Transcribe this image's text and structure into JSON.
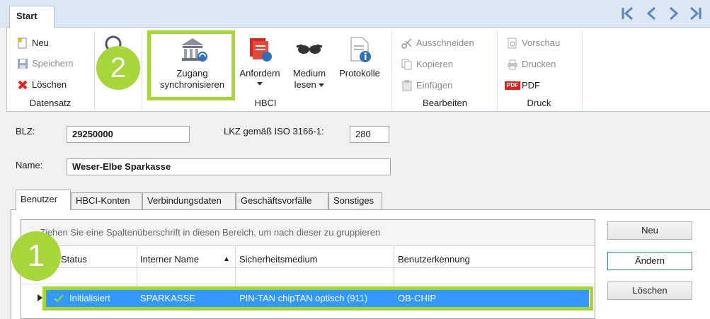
{
  "tabs": {
    "start": "Start"
  },
  "nav": {
    "first": "K",
    "prev": "<",
    "next": ">",
    "last": ">|"
  },
  "datensatz": {
    "new": "Neu",
    "save": "Speichern",
    "delete": "Löschen",
    "group": "Datensatz"
  },
  "hbci": {
    "sync_line1": "Zugang",
    "sync_line2": "synchronisieren",
    "request": "Anfordern",
    "medium_line1": "Medium",
    "medium_line2": "lesen",
    "protocols": "Protokolle",
    "group": "HBCI"
  },
  "bearbeiten": {
    "cut": "Ausschneiden",
    "copy": "Kopieren",
    "paste": "Einfügen",
    "group": "Bearbeiten"
  },
  "druck": {
    "preview": "Vorschau",
    "print": "Drucken",
    "pdf_badge": "PDF",
    "pdf": "PDF",
    "group": "Druck"
  },
  "form": {
    "blz_label": "BLZ:",
    "blz_value": "29250000",
    "lkz_label": "LKZ gemäß ISO 3166-1:",
    "lkz_value": "280",
    "name_label": "Name:",
    "name_value": "Weser-Elbe Sparkasse"
  },
  "detail_tabs": [
    "Benutzer",
    "HBCI-Konten",
    "Verbindungsdaten",
    "Geschäftsvorfälle",
    "Sonstiges"
  ],
  "grid": {
    "group_hint": "Ziehen Sie eine Spaltenüberschrift in diesen Bereich, um nach dieser zu gruppieren",
    "headers": [
      "Status",
      "Interner Name",
      "Sicherheitsmedium",
      "Benutzerkennung"
    ],
    "sort_indicator": "▲",
    "row": [
      "Initialisiert",
      "SPARKASSE",
      "PIN-TAN chipTAN optisch (911)",
      "OB-CHIP"
    ]
  },
  "side_buttons": {
    "new": "Neu",
    "edit": "Ändern",
    "delete": "Löschen"
  },
  "badges": {
    "one": "1",
    "two": "2"
  },
  "colors": {
    "highlight": "#a6d63a",
    "selection": "#3399ff",
    "ribbon_bg": "#dbe7f3"
  }
}
